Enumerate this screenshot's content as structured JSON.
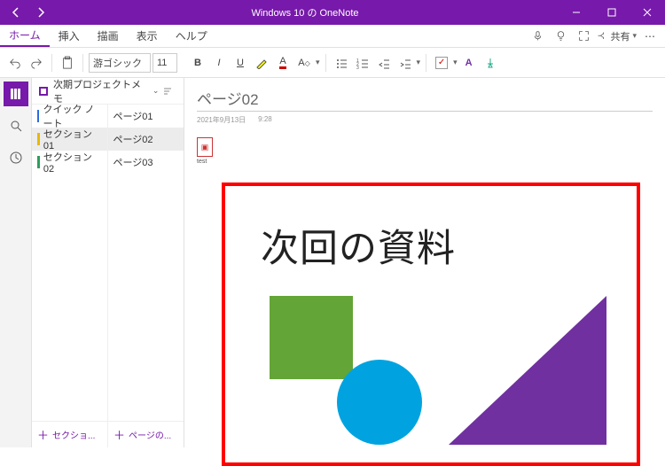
{
  "title_bar": {
    "title": "Windows 10 の OneNote"
  },
  "menu": {
    "tabs": [
      "ホーム",
      "挿入",
      "描画",
      "表示",
      "ヘルプ"
    ],
    "active_index": 0,
    "share_label": "共有"
  },
  "ribbon": {
    "font_name": "游ゴシック",
    "font_size": "11",
    "bold": "B",
    "italic": "I",
    "underline": "U"
  },
  "rail": {
    "items": [
      "notebooks",
      "search",
      "history"
    ]
  },
  "notebook": {
    "title": "次期プロジェクトメモ"
  },
  "sections": [
    {
      "label": "クイック ノート",
      "color": "#2d6cdf"
    },
    {
      "label": "セクション01",
      "color": "#e6b800"
    },
    {
      "label": "セクション02",
      "color": "#2e9e5b"
    }
  ],
  "pages": [
    {
      "label": "ページ01"
    },
    {
      "label": "ページ02"
    },
    {
      "label": "ページ03"
    }
  ],
  "selected_section_index": 1,
  "selected_page_index": 1,
  "add": {
    "section_label": "セクショ...",
    "page_label": "ページの..."
  },
  "page": {
    "title": "ページ02",
    "date": "2021年9月13日",
    "time": "9:28",
    "attachment_label": "test",
    "slide_title": "次回の資料"
  }
}
